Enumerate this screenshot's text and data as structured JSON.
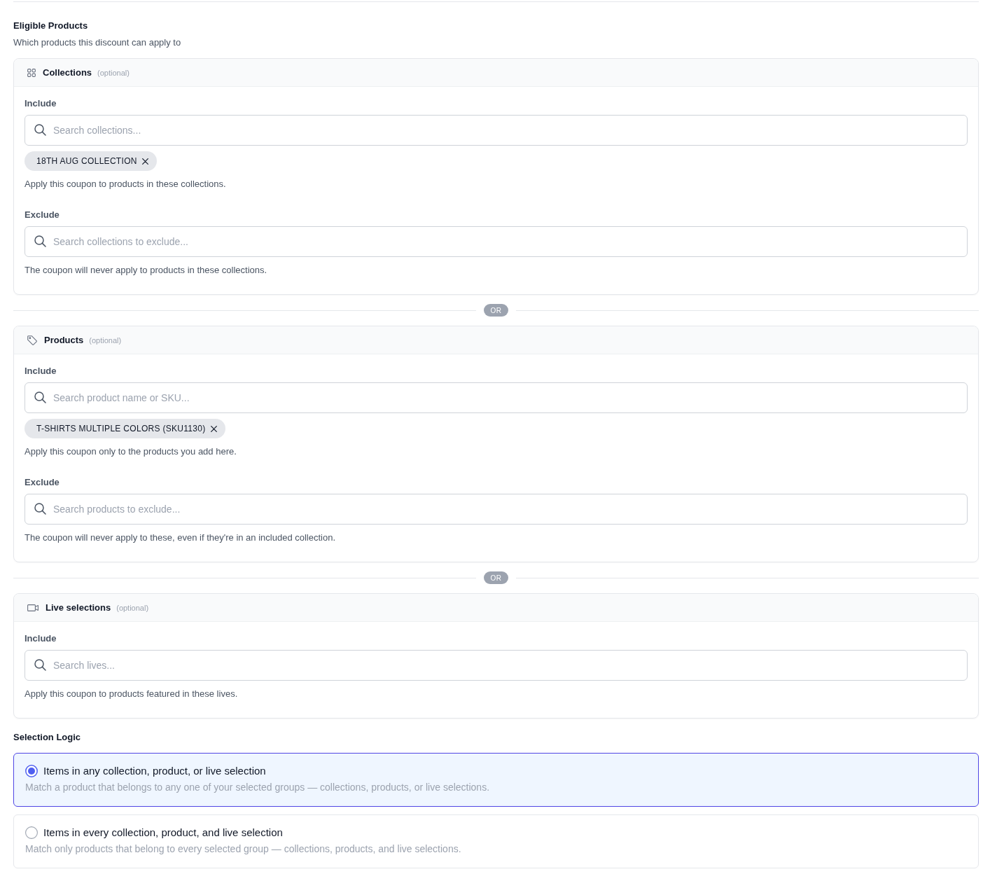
{
  "section": {
    "title": "Eligible Products",
    "subtitle": "Which products this discount can apply to"
  },
  "blocks": [
    {
      "kind": "collections",
      "title": "Collections",
      "note": "(optional)",
      "fields": [
        {
          "label": "Include",
          "placeholder": "Search collections...",
          "chips": [
            "18TH AUG COLLECTION"
          ],
          "help": "Apply this coupon to products in these collections."
        },
        {
          "label": "Exclude",
          "placeholder": "Search collections to exclude...",
          "help": "The coupon will never apply to products in these collections."
        }
      ]
    },
    {
      "kind": "divider",
      "label": "OR"
    },
    {
      "kind": "products",
      "title": "Products",
      "note": "(optional)",
      "fields": [
        {
          "label": "Include",
          "placeholder": "Search product name or SKU...",
          "chips": [
            "T-SHIRTS MULTIPLE COLORS (SKU1130)"
          ],
          "help": "Apply this coupon only to the products you add here."
        },
        {
          "label": "Exclude",
          "placeholder": "Search products to exclude...",
          "help": "The coupon will never apply to these, even if they're in an included collection."
        }
      ]
    },
    {
      "kind": "divider",
      "label": "OR"
    },
    {
      "kind": "lives",
      "title": "Live selections",
      "note": "(optional)",
      "fields": [
        {
          "label": "Include",
          "placeholder": "Search lives...",
          "help": "Apply this coupon to products featured in these lives."
        }
      ]
    }
  ],
  "selection_logic": {
    "title": "Selection Logic",
    "options": [
      {
        "label": "Items in any collection, product, or live selection",
        "description": "Match a product that belongs to any one of your selected groups — collections, products, or live selections.",
        "selected": true
      },
      {
        "label": "Items in every collection, product, and live selection",
        "description": "Match only products that belong to every selected group — collections, products, and live selections.",
        "selected": false
      }
    ]
  }
}
